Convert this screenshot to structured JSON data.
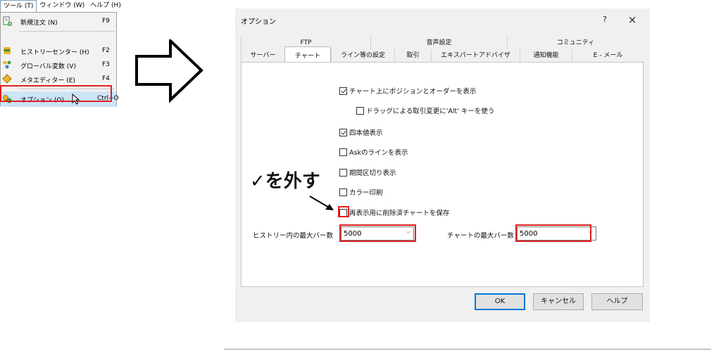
{
  "menubar": {
    "items": [
      "ツール (T)",
      "ウィンドウ (W)",
      "ヘルプ (H)"
    ]
  },
  "menu": {
    "items": [
      {
        "label": "新規注文 (N)",
        "shortcut": "F9",
        "icon": "new-order-icon"
      },
      {
        "label": "ヒストリーセンター (H)",
        "shortcut": "F2",
        "icon": "history-center-icon"
      },
      {
        "label": "グローバル変数 (V)",
        "shortcut": "F3",
        "icon": "global-variables-icon"
      },
      {
        "label": "メタエディター (E)",
        "shortcut": "F4",
        "icon": "metaeditor-icon"
      },
      {
        "label": "オプション (O)",
        "shortcut": "Ctrl+O",
        "icon": "options-icon"
      }
    ],
    "highlight_color": "#e02020"
  },
  "dialog": {
    "title": "オプション",
    "help_label": "?",
    "close_label": "×",
    "tabs_row1": [
      "FTP",
      "音声設定",
      "コミュニティ"
    ],
    "tabs_row2": [
      "サーバー",
      "チャート",
      "ライン等の設定",
      "取引",
      "エキスパートアドバイザ",
      "通知機能",
      "E - メール"
    ],
    "selected_tab": "チャート",
    "options": [
      {
        "label": "チャート上にポジションとオーダーを表示",
        "checked": true
      },
      {
        "label": "ドラッグによる取引変更に'Alt' キーを使う",
        "checked": false
      },
      {
        "label": "四本値表示",
        "checked": true
      },
      {
        "label": "Askのラインを表示",
        "checked": false
      },
      {
        "label": "期間区切り表示",
        "checked": false
      },
      {
        "label": "カラー印刷",
        "checked": false
      },
      {
        "label": "再表示用に削除済チャートを保存",
        "checked": false
      }
    ],
    "max_bars_history_label": "ヒストリー内の最大バー数",
    "max_bars_history_value": "5000",
    "max_bars_chart_label": "チャートの最大バー数",
    "max_bars_chart_value": "5000",
    "buttons": {
      "ok": "OK",
      "cancel": "キャンセル",
      "help": "ヘルプ"
    }
  },
  "annotation": {
    "text": "✓を外す"
  }
}
